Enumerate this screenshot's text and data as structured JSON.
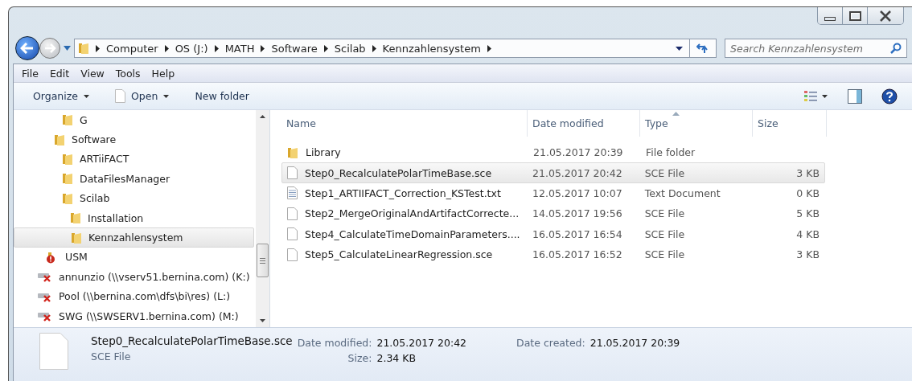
{
  "breadcrumb": [
    "Computer",
    "OS (J:)",
    "MATH",
    "Software",
    "Scilab",
    "Kennzahlensystem"
  ],
  "search": {
    "placeholder": "Search Kennzahlensystem"
  },
  "menu": [
    "File",
    "Edit",
    "View",
    "Tools",
    "Help"
  ],
  "toolbar": {
    "organize": "Organize",
    "open": "Open",
    "new_folder": "New folder"
  },
  "tree": [
    {
      "children": [
        {
          "children": [
            {
              "children": [
                {
                  "label": "G",
                  "kind": "folder",
                  "selected": false
                }
              ]
            },
            {
              "label": "Software",
              "kind": "folder",
              "selected": false,
              "children": [
                {
                  "label": "ARTiiFACT",
                  "kind": "folder",
                  "selected": false
                },
                {
                  "label": "DataFilesManager",
                  "kind": "folder",
                  "selected": false
                },
                {
                  "label": "Scilab",
                  "kind": "folder",
                  "selected": false,
                  "children": [
                    {
                      "label": "Installation",
                      "kind": "folder",
                      "selected": false
                    },
                    {
                      "label": "Kennzahlensystem",
                      "kind": "folder",
                      "selected": true
                    }
                  ]
                }
              ]
            }
          ]
        },
        {
          "label": "USM",
          "kind": "alert",
          "selected": false
        }
      ]
    },
    {
      "label": "annunzio (\\\\vserv51.bernina.com) (K:)",
      "kind": "netdrive",
      "selected": false
    },
    {
      "label": "Pool (\\\\bernina.com\\dfs\\bi\\res) (L:)",
      "kind": "netdrive",
      "selected": false
    },
    {
      "label": "SWG (\\\\SWSERV1.bernina.com) (M:)",
      "kind": "netdrive",
      "selected": false
    }
  ],
  "columns": [
    "Name",
    "Date modified",
    "Type",
    "Size"
  ],
  "files": [
    {
      "name": "Library",
      "date": "21.05.2017 20:39",
      "type": "File folder",
      "kind": "folder",
      "selected": false
    },
    {
      "name": "Step0_RecalculatePolarTimeBase.sce",
      "date": "21.05.2017 20:42",
      "type": "SCE File",
      "size": "3 KB",
      "kind": "file",
      "selected": true
    },
    {
      "name": "Step1_ARTIIFACT_Correction_KSTest.txt",
      "date": "12.05.2017 10:07",
      "type": "Text Document",
      "size": "0 KB",
      "kind": "text",
      "selected": false
    },
    {
      "name": "Step2_MergeOriginalAndArtifactCorrecte...",
      "date": "14.05.2017 19:56",
      "type": "SCE File",
      "size": "5 KB",
      "kind": "file",
      "selected": false
    },
    {
      "name": "Step4_CalculateTimeDomainParameters....",
      "date": "16.05.2017 16:54",
      "type": "SCE File",
      "size": "4 KB",
      "kind": "file",
      "selected": false
    },
    {
      "name": "Step5_CalculateLinearRegression.sce",
      "date": "16.05.2017 16:52",
      "type": "SCE File",
      "size": "3 KB",
      "kind": "file",
      "selected": false
    }
  ],
  "details": {
    "name": "Step0_RecalculatePolarTimeBase.sce",
    "type": "SCE File",
    "modified_label": "Date modified:",
    "modified": "21.05.2017 20:42",
    "size_label": "Size:",
    "size": "2.34 KB",
    "created_label": "Date created:",
    "created": "21.05.2017 20:39"
  }
}
